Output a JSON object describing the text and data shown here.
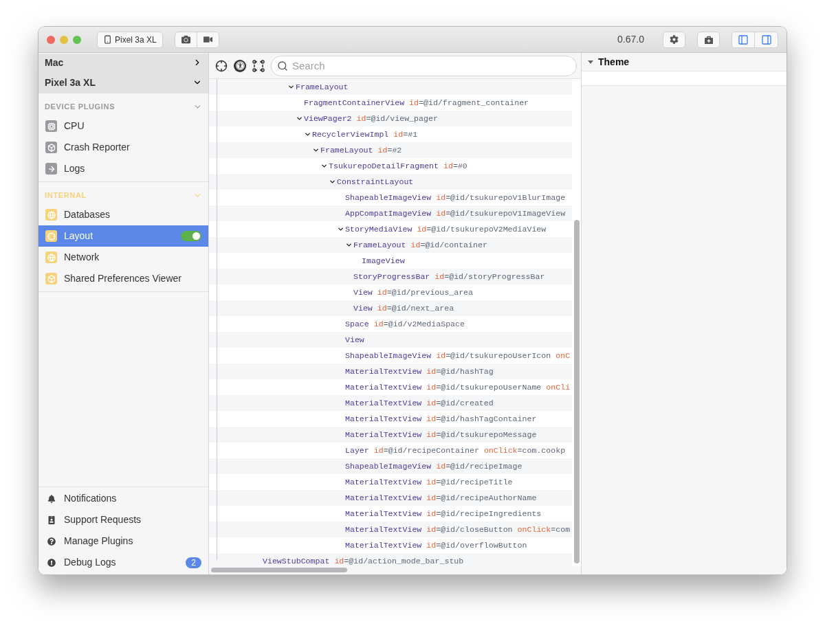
{
  "titlebar": {
    "device_button": "Pixel 3a XL",
    "version": "0.67.0"
  },
  "sidebar": {
    "devices": [
      {
        "label": "Mac",
        "expanded": false
      },
      {
        "label": "Pixel 3a XL",
        "expanded": true
      }
    ],
    "sections": [
      {
        "title": "DEVICE PLUGINS",
        "expanded": true,
        "color": "#9a9a9e",
        "items": [
          {
            "label": "CPU",
            "kind": "cpu",
            "selected": false
          },
          {
            "label": "Crash Reporter",
            "kind": "box",
            "selected": false
          },
          {
            "label": "Logs",
            "kind": "arrow",
            "selected": false
          }
        ]
      },
      {
        "title": "INTERNAL",
        "expanded": true,
        "color": "#f6d27a",
        "items": [
          {
            "label": "Databases",
            "kind": "globe",
            "selected": false
          },
          {
            "label": "Layout",
            "kind": "target",
            "selected": true,
            "on": true
          },
          {
            "label": "Network",
            "kind": "globe",
            "selected": false
          },
          {
            "label": "Shared Preferences Viewer",
            "kind": "box",
            "selected": false
          }
        ]
      }
    ],
    "footer": [
      {
        "label": "Notifications",
        "kind": "bell"
      },
      {
        "label": "Support Requests",
        "kind": "badge"
      },
      {
        "label": "Manage Plugins",
        "kind": "question"
      },
      {
        "label": "Debug Logs",
        "kind": "alert",
        "badge": "2"
      }
    ]
  },
  "search": {
    "placeholder": "Search"
  },
  "tree": [
    {
      "children": [
        {
          "children": [
            {
              "children": [
                {
                  "children": [
                    {
                      "name": "FrameLayout",
                      "expanded": true,
                      "children": [
                        {
                          "name": "FragmentContainerView",
                          "attrs": [
                            {
                              "key": "id",
                              "value": "=@id/fragment_container"
                            }
                          ]
                        },
                        {
                          "name": "ViewPager2",
                          "attrs": [
                            {
                              "key": "id",
                              "value": "=@id/view_pager"
                            }
                          ],
                          "expanded": true,
                          "children": [
                            {
                              "name": "RecyclerViewImpl",
                              "attrs": [
                                {
                                  "key": "id",
                                  "value": "=#1"
                                }
                              ],
                              "expanded": true,
                              "children": [
                                {
                                  "name": "FrameLayout",
                                  "attrs": [
                                    {
                                      "key": "id",
                                      "value": "=#2"
                                    }
                                  ],
                                  "expanded": true,
                                  "children": [
                                    {
                                      "name": "TsukurepoDetailFragment",
                                      "attrs": [
                                        {
                                          "key": "id",
                                          "value": "=#0"
                                        }
                                      ],
                                      "expanded": true,
                                      "children": [
                                        {
                                          "name": "ConstraintLayout",
                                          "expanded": true,
                                          "children": [
                                            {
                                              "name": "ShapeableImageView",
                                              "attrs": [
                                                {
                                                  "key": "id",
                                                  "value": "=@id/tsukurepoV1BlurImage"
                                                }
                                              ]
                                            },
                                            {
                                              "name": "AppCompatImageView",
                                              "attrs": [
                                                {
                                                  "key": "id",
                                                  "value": "=@id/tsukurepoV1ImageView"
                                                }
                                              ]
                                            },
                                            {
                                              "name": "StoryMediaView",
                                              "attrs": [
                                                {
                                                  "key": "id",
                                                  "value": "=@id/tsukurepoV2MediaView"
                                                }
                                              ],
                                              "expanded": true,
                                              "children": [
                                                {
                                                  "name": "FrameLayout",
                                                  "attrs": [
                                                    {
                                                      "key": "id",
                                                      "value": "=@id/container"
                                                    }
                                                  ],
                                                  "expanded": true,
                                                  "children": [
                                                    {
                                                      "name": "ImageView"
                                                    }
                                                  ]
                                                },
                                                {
                                                  "name": "StoryProgressBar",
                                                  "attrs": [
                                                    {
                                                      "key": "id",
                                                      "value": "=@id/storyProgressBar"
                                                    }
                                                  ]
                                                },
                                                {
                                                  "name": "View",
                                                  "attrs": [
                                                    {
                                                      "key": "id",
                                                      "value": "=@id/previous_area"
                                                    }
                                                  ]
                                                },
                                                {
                                                  "name": "View",
                                                  "attrs": [
                                                    {
                                                      "key": "id",
                                                      "value": "=@id/next_area"
                                                    }
                                                  ]
                                                }
                                              ]
                                            },
                                            {
                                              "name": "Space",
                                              "attrs": [
                                                {
                                                  "key": "id",
                                                  "value": "=@id/v2MediaSpace"
                                                }
                                              ]
                                            },
                                            {
                                              "name": "View"
                                            },
                                            {
                                              "name": "ShapeableImageView",
                                              "attrs": [
                                                {
                                                  "key": "id",
                                                  "value": "=@id/tsukurepoUserIcon"
                                                },
                                                {
                                                  "key": "onC"
                                                }
                                              ]
                                            },
                                            {
                                              "name": "MaterialTextView",
                                              "attrs": [
                                                {
                                                  "key": "id",
                                                  "value": "=@id/hashTag"
                                                }
                                              ]
                                            },
                                            {
                                              "name": "MaterialTextView",
                                              "attrs": [
                                                {
                                                  "key": "id",
                                                  "value": "=@id/tsukurepoUserName"
                                                },
                                                {
                                                  "key": "onCli"
                                                }
                                              ]
                                            },
                                            {
                                              "name": "MaterialTextView",
                                              "attrs": [
                                                {
                                                  "key": "id",
                                                  "value": "=@id/created"
                                                }
                                              ]
                                            },
                                            {
                                              "name": "MaterialTextView",
                                              "attrs": [
                                                {
                                                  "key": "id",
                                                  "value": "=@id/hashTagContainer"
                                                }
                                              ]
                                            },
                                            {
                                              "name": "MaterialTextView",
                                              "attrs": [
                                                {
                                                  "key": "id",
                                                  "value": "=@id/tsukurepoMessage"
                                                }
                                              ]
                                            },
                                            {
                                              "name": "Layer",
                                              "attrs": [
                                                {
                                                  "key": "id",
                                                  "value": "=@id/recipeContainer"
                                                },
                                                {
                                                  "key": "onClick",
                                                  "value": "=com.cookp"
                                                }
                                              ]
                                            },
                                            {
                                              "name": "ShapeableImageView",
                                              "attrs": [
                                                {
                                                  "key": "id",
                                                  "value": "=@id/recipeImage"
                                                }
                                              ]
                                            },
                                            {
                                              "name": "MaterialTextView",
                                              "attrs": [
                                                {
                                                  "key": "id",
                                                  "value": "=@id/recipeTitle"
                                                }
                                              ]
                                            },
                                            {
                                              "name": "MaterialTextView",
                                              "attrs": [
                                                {
                                                  "key": "id",
                                                  "value": "=@id/recipeAuthorName"
                                                }
                                              ]
                                            },
                                            {
                                              "name": "MaterialTextView",
                                              "attrs": [
                                                {
                                                  "key": "id",
                                                  "value": "=@id/recipeIngredients"
                                                }
                                              ]
                                            },
                                            {
                                              "name": "MaterialTextView",
                                              "attrs": [
                                                {
                                                  "key": "id",
                                                  "value": "=@id/closeButton"
                                                },
                                                {
                                                  "key": "onClick",
                                                  "value": "=com"
                                                }
                                              ]
                                            },
                                            {
                                              "name": "MaterialTextView",
                                              "attrs": [
                                                {
                                                  "key": "id",
                                                  "value": "=@id/overflowButton"
                                                }
                                              ]
                                            }
                                          ]
                                        }
                                      ]
                                    }
                                  ]
                                }
                              ]
                            }
                          ]
                        }
                      ]
                    }
                  ]
                }
              ]
            }
          ]
        }
      ]
    },
    {
      "name": "ViewStubCompat",
      "attrs": [
        {
          "key": "id",
          "value": "=@id/action_mode_bar_stub"
        }
      ]
    }
  ],
  "inspector": {
    "sections": [
      {
        "title": "Theme",
        "expanded": true
      }
    ]
  }
}
